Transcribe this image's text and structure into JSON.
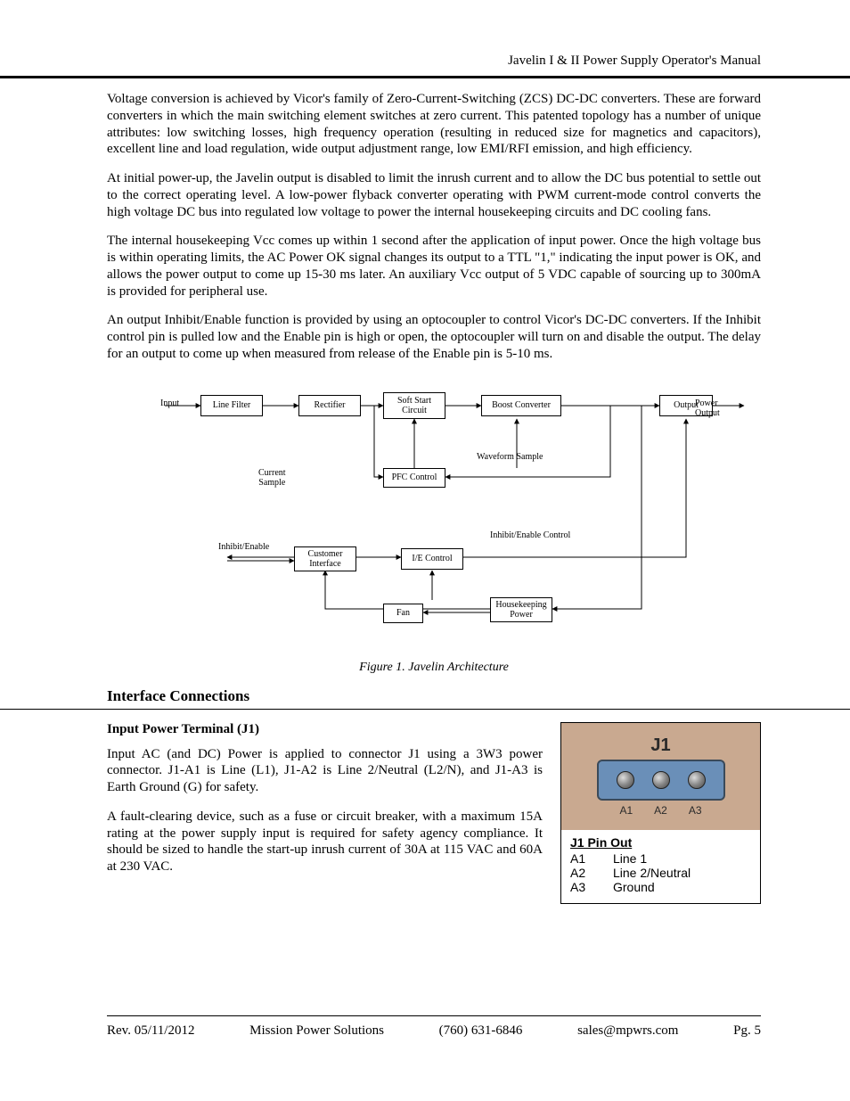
{
  "header": {
    "title": "Javelin I & II Power Supply Operator's Manual"
  },
  "paragraphs": {
    "p1": "Voltage conversion is achieved by Vicor's family of Zero-Current-Switching (ZCS) DC-DC converters.  These are forward converters in which the main switching element switches at zero current.  This patented topology has a number of unique attributes: low switching losses, high frequency operation (resulting in reduced size for magnetics and capacitors), excellent line and load regulation, wide output adjustment range, low EMI/RFI emission, and high efficiency.",
    "p2": "At initial power-up, the Javelin output is disabled to limit the inrush current and to allow the DC bus potential to settle out to the correct operating level.  A low-power flyback converter operating with PWM current-mode control converts the high voltage DC bus into regulated low voltage to power the internal housekeeping circuits and DC cooling fans.",
    "p3": "The internal housekeeping Vcc comes up within 1 second after the application of input power.  Once the high voltage bus is within operating limits, the AC Power OK signal changes its output to a TTL \"1,\" indicating the input power is OK, and allows the power output to come up 15-30 ms later.  An auxiliary Vcc output of 5 VDC capable of sourcing up to 300mA is provided for peripheral use.",
    "p4": "An output Inhibit/Enable function is provided by using an optocoupler to control Vicor's DC-DC converters.  If the Inhibit control pin is pulled low and the Enable pin is high or open, the optocoupler will turn on and disable the output.  The delay for an output to come up when measured from release of the Enable pin is 5-10 ms."
  },
  "diagram": {
    "input": "Input",
    "line_filter": "Line Filter",
    "rectifier": "Rectifier",
    "soft_start": "Soft Start\nCircuit",
    "boost_conv": "Boost Converter",
    "output_box": "Output",
    "power_output": "Power\nOutput",
    "waveform": "Waveform Sample",
    "current_sample": "Current\nSample",
    "pfc": "PFC Control",
    "inhibit_enable": "Inhibit/Enable",
    "customer_if": "Customer\nInterface",
    "ie_control": "I/E Control",
    "ie_control_lbl": "Inhibit/Enable Control",
    "fan": "Fan",
    "housekeeping": "Housekeeping\nPower",
    "caption": "Figure 1. Javelin Architecture"
  },
  "sections": {
    "interface": "Interface Connections",
    "input_terminal": "Input Power Terminal (J1)",
    "j1_p1": "Input AC (and DC) Power is applied to connector J1 using a 3W3 power connector. J1-A1 is Line (L1), J1-A2 is Line 2/Neutral (L2/N), and J1-A3 is Earth Ground (G) for safety.",
    "j1_p2": "A fault-clearing device, such as a fuse or circuit breaker, with a maximum 15A rating at the power supply input is required for safety agency compliance.  It should be sized to handle the start-up inrush current of 30A at 115 VAC and 60A at 230 VAC."
  },
  "pinout": {
    "conn_label": "J1",
    "pinlabel1": "A1",
    "pinlabel2": "A2",
    "pinlabel3": "A3",
    "title": "J1 Pin Out",
    "rows": [
      {
        "pin": "A1",
        "desc": "Line 1"
      },
      {
        "pin": "A2",
        "desc": "Line 2/Neutral"
      },
      {
        "pin": "A3",
        "desc": "Ground"
      }
    ]
  },
  "footer": {
    "rev": "Rev. 05/11/2012",
    "company": "Mission Power Solutions",
    "phone": "(760) 631-6846",
    "email": "sales@mpwrs.com",
    "page": "Pg. 5"
  }
}
